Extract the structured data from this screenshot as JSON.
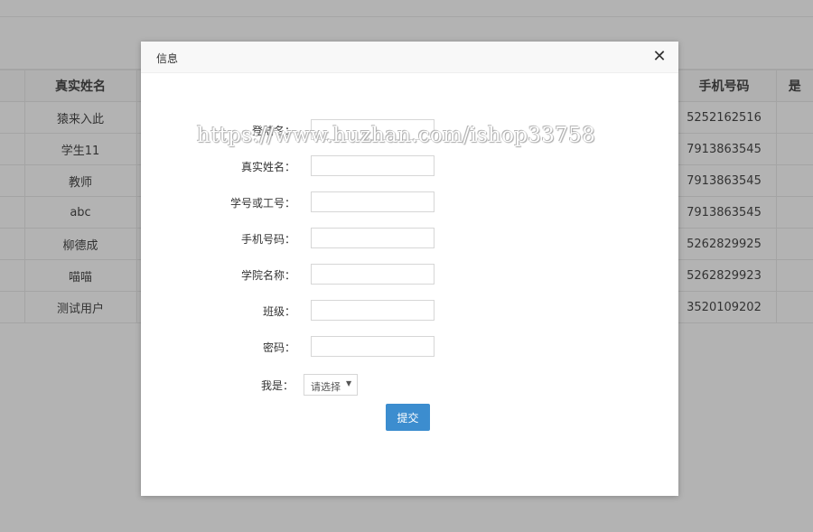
{
  "background_table": {
    "headers": [
      "",
      "真实姓名",
      "",
      "手机号码",
      "是"
    ],
    "rows": [
      {
        "name": "猿来入此",
        "phone": "5252162516"
      },
      {
        "name": "学生11",
        "phone": "7913863545"
      },
      {
        "name": "教师",
        "phone": "7913863545"
      },
      {
        "name": "abc",
        "phone": "7913863545"
      },
      {
        "name": "柳德成",
        "phone": "5262829925"
      },
      {
        "name": "喵喵",
        "phone": "5262829923"
      },
      {
        "name": "测试用户",
        "phone": "3520109202"
      }
    ]
  },
  "modal": {
    "title": "信息",
    "close_icon": "close-icon",
    "fields": [
      {
        "label": "登陆名：",
        "value": ""
      },
      {
        "label": "真实姓名：",
        "value": ""
      },
      {
        "label": "学号或工号：",
        "value": ""
      },
      {
        "label": "手机号码：",
        "value": ""
      },
      {
        "label": "学院名称：",
        "value": ""
      },
      {
        "label": "班级：",
        "value": ""
      },
      {
        "label": "密码：",
        "value": ""
      }
    ],
    "role": {
      "label": "我是：",
      "selected": "请选择"
    },
    "submit_label": "提交"
  },
  "watermark": "https://www.huzhan.com/ishop33758",
  "colors": {
    "overlay": "#b3b3b3",
    "primary_button": "#3c8dcf"
  }
}
